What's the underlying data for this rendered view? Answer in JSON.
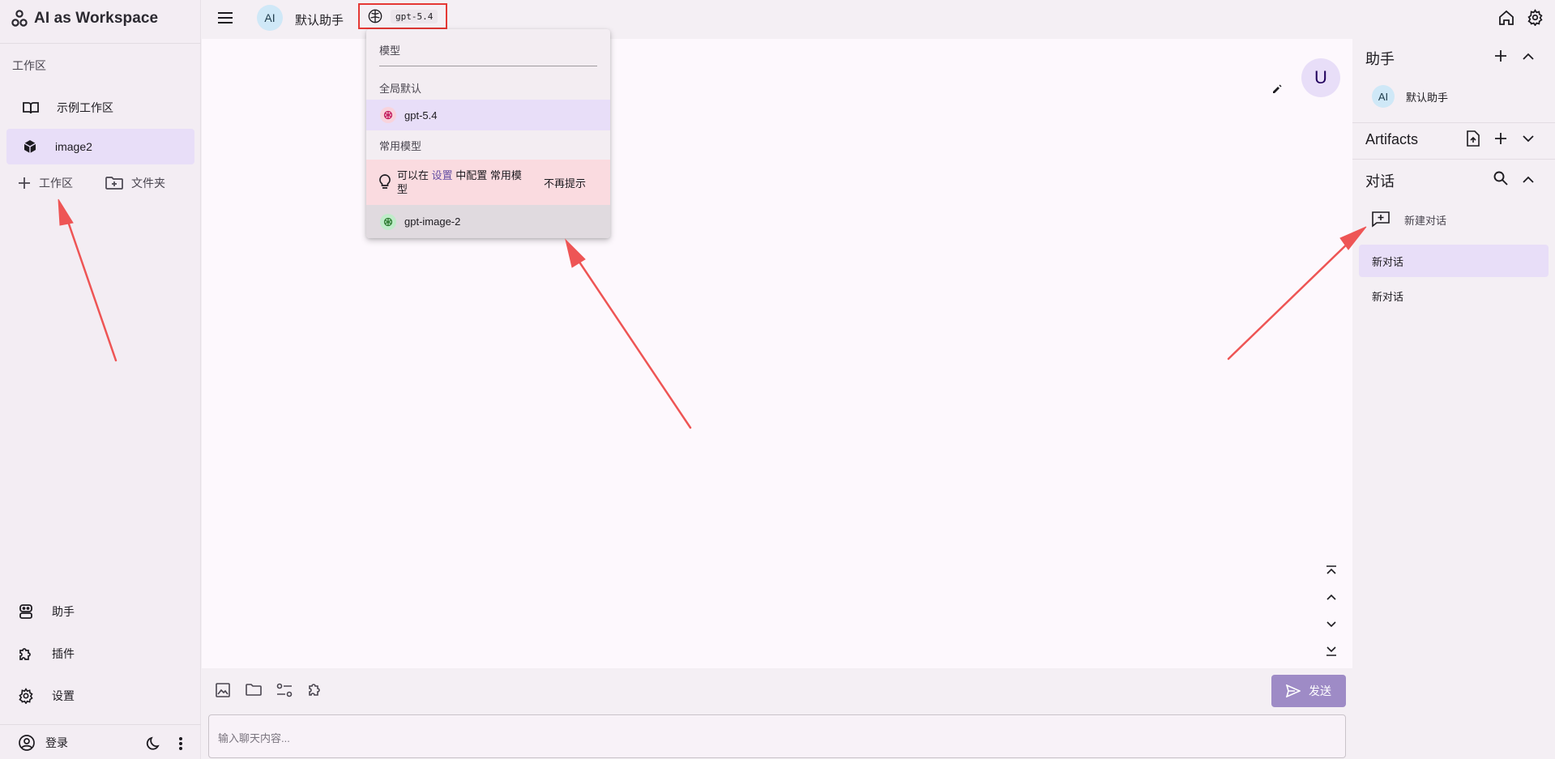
{
  "app": {
    "title": "AI as Workspace"
  },
  "sidebar": {
    "section_label": "工作区",
    "workspaces": [
      {
        "label": "示例工作区",
        "icon": "book-open-icon",
        "active": false
      },
      {
        "label": "image2",
        "icon": "cube-icon",
        "active": true
      }
    ],
    "add_workspace_label": "工作区",
    "add_folder_label": "文件夹",
    "nav": [
      {
        "label": "助手",
        "icon": "robot-icon"
      },
      {
        "label": "插件",
        "icon": "puzzle-icon"
      },
      {
        "label": "设置",
        "icon": "gear-icon"
      }
    ],
    "login_label": "登录"
  },
  "header": {
    "assistant_avatar": "AI",
    "assistant_name": "默认助手",
    "model_chip": "gpt-5.4"
  },
  "dropdown": {
    "title": "模型",
    "global_default_label": "全局默认",
    "global_default_model": "gpt-5.4",
    "common_label": "常用模型",
    "tip_prefix": "可以在 ",
    "tip_link": "设置",
    "tip_suffix": " 中配置 常用模型",
    "tip_dismiss": "不再提示",
    "common_models": [
      "gpt-image-2"
    ]
  },
  "chat": {
    "user_avatar": "U",
    "send_label": "发送",
    "input_placeholder": "输入聊天内容..."
  },
  "right_panel": {
    "assistants_title": "助手",
    "assistant_item": {
      "avatar": "AI",
      "label": "默认助手"
    },
    "artifacts_title": "Artifacts",
    "conversations_title": "对话",
    "new_conversation_label": "新建对话",
    "conversations": [
      {
        "label": "新对话",
        "active": true
      },
      {
        "label": "新对话",
        "active": false
      }
    ]
  },
  "colors": {
    "accent": "#e8def8",
    "primary": "#9e8bc6",
    "highlight_border": "#e53935",
    "tip_background": "#fadbe0",
    "annotation_arrow": "#ee5555"
  }
}
